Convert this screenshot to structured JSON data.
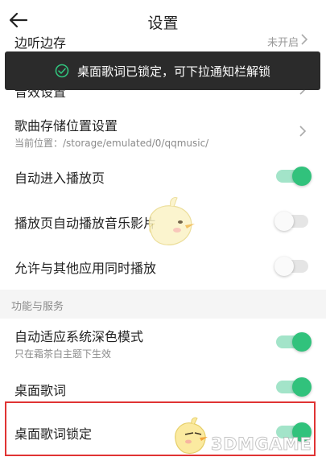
{
  "header": {
    "title": "设置"
  },
  "hidden_row": {
    "label": "边听边存",
    "value": "未开启"
  },
  "toast": {
    "message": "桌面歌词已锁定，可下拉通知栏解锁"
  },
  "rows": [
    {
      "label": "音效设置"
    },
    {
      "label": "歌曲存储位置设置",
      "subtitle": "当前位置：/storage/emulated/0/qqmusic/"
    },
    {
      "label": "自动进入播放页",
      "toggle": "on"
    },
    {
      "label": "播放页自动播放音乐影片",
      "toggle": "off"
    },
    {
      "label": "允许与其他应用同时播放",
      "toggle": "off"
    }
  ],
  "section": {
    "title": "功能与服务"
  },
  "rows2": [
    {
      "label": "自动适应系统深色模式",
      "subtitle": "只在霜茶白主题下生效",
      "toggle": "on"
    },
    {
      "label": "桌面歌词",
      "toggle": "on"
    },
    {
      "label": "桌面歌词锁定",
      "toggle": "on"
    }
  ],
  "watermark": {
    "text": "3DMGAME"
  },
  "colors": {
    "accent": "#31c27c",
    "toast_bg": "#2b2b2b",
    "highlight": "#e03434"
  },
  "icons": [
    "back-arrow-icon",
    "check-circle-icon",
    "chevron-right-icon",
    "mascot-chick-icon"
  ]
}
